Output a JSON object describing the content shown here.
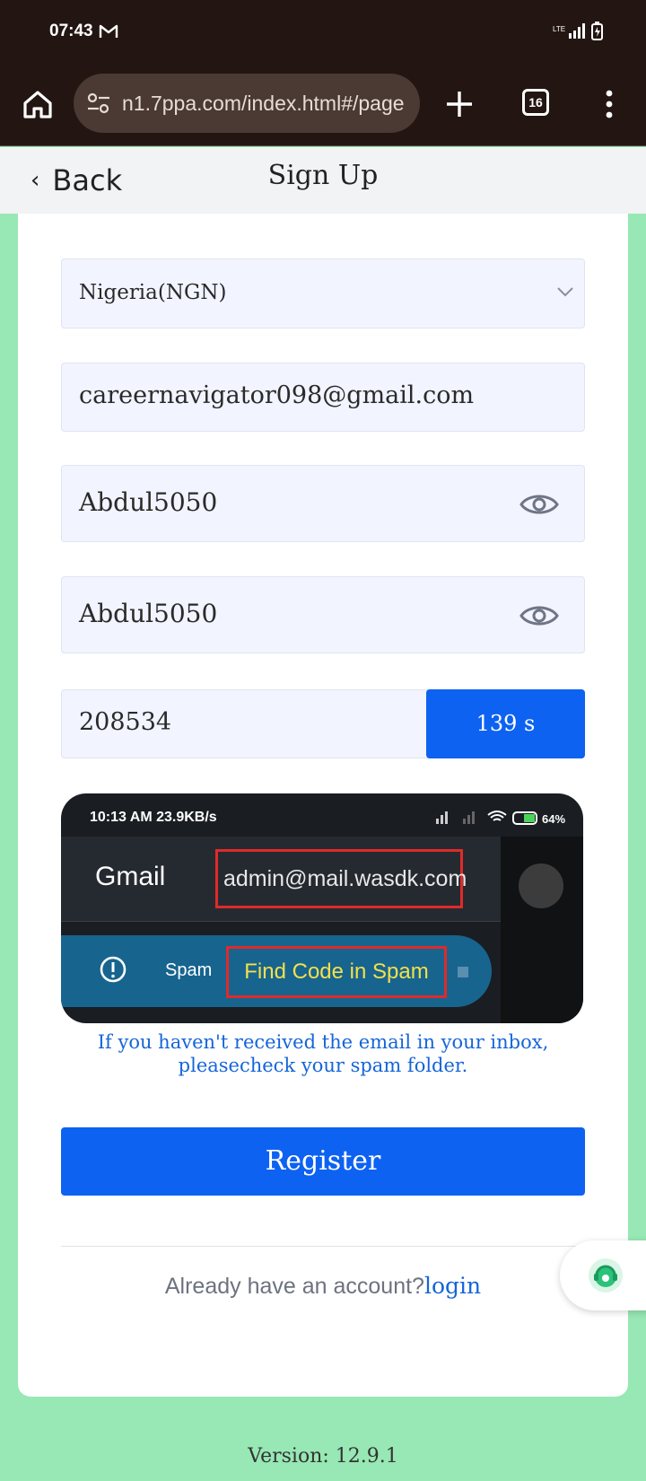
{
  "status_bar": {
    "time": "07:43"
  },
  "browser": {
    "url": "n1.7ppa.com/index.html#/page",
    "tab_count": "16"
  },
  "header": {
    "back_label": "Back",
    "title": "Sign Up"
  },
  "form": {
    "country": "Nigeria(NGN)",
    "email": "careernavigator098@gmail.com",
    "password": "Abdul5050",
    "confirm_password": "Abdul5050",
    "code": "208534",
    "timer": "139 s"
  },
  "hint_image": {
    "time": "10:13 AM  23.9KB/s",
    "gmail": "Gmail",
    "sender": "admin@mail.wasdk.com",
    "spam": "Spam",
    "find": "Find Code in Spam"
  },
  "hint_text": "If you haven't received the email in your inbox, pleasecheck your spam folder.",
  "register_label": "Register",
  "footer": {
    "question": "Already have an account?",
    "login": "login"
  },
  "version": "Version: 12.9.1",
  "colors": {
    "accent": "#0d62f2",
    "link": "#1565d8",
    "background": "#97e8b4"
  }
}
